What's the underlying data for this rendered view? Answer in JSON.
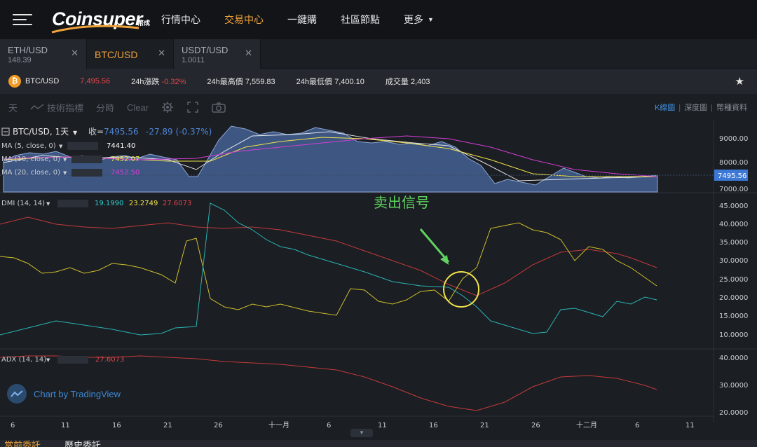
{
  "header": {
    "logo": "Coinsuper",
    "logo_sub": "幣成",
    "nav": [
      {
        "label": "行情中心",
        "active": false
      },
      {
        "label": "交易中心",
        "active": true
      },
      {
        "label": "一鍵購",
        "active": false
      },
      {
        "label": "社區節點",
        "active": false
      }
    ],
    "more_label": "更多"
  },
  "tabs": [
    {
      "pair": "ETH/USD",
      "price": "148.39",
      "active": false
    },
    {
      "pair": "BTC/USD",
      "price": "",
      "active": true
    },
    {
      "pair": "USDT/USD",
      "price": "1.0011",
      "active": false
    }
  ],
  "ticker": {
    "symbol": "BTC/USD",
    "last": "7,495.56",
    "change_label": "24h漲跌",
    "change_value": "-0.32%",
    "high_label": "24h最高價",
    "high_value": "7,559.83",
    "low_label": "24h最低價",
    "low_value": "7,400.10",
    "volume_label": "成交量",
    "volume_value": "2,403"
  },
  "toolbar": {
    "interval": "天",
    "indicators": "技術指標",
    "timeshare": "分時",
    "clear": "Clear",
    "views": [
      "K線圖",
      "深度圖",
      "幣種資料"
    ]
  },
  "chart": {
    "main_legend": "BTC/USD, 1天",
    "close_label": "收=",
    "close_value": "7495.56",
    "change": "-27.89 (-0.37%)",
    "ma5_label": "MA (5, close, 0)",
    "ma5_value": "7441.40",
    "ma10_label": "MA (10, close, 0)",
    "ma10_value": "7452.07",
    "ma20_label": "MA (20, close, 0)",
    "ma20_value": "7452.50",
    "dmi_label": "DMI (14, 14)",
    "dmi_v1": "19.1990",
    "dmi_v2": "23.2749",
    "dmi_v3": "27.6073",
    "adx_label": "ADX (14, 14)",
    "adx_value": "27.6073",
    "annotation": "卖出信号",
    "price_ticks": [
      "9000.00",
      "8000.00",
      "7000.00"
    ],
    "last_price_tag": "7495.56",
    "dmi_ticks": [
      "45.0000",
      "40.0000",
      "35.0000",
      "30.0000",
      "25.0000",
      "20.0000",
      "15.0000",
      "10.0000"
    ],
    "adx_ticks": [
      "40.0000",
      "30.0000",
      "20.0000"
    ],
    "date_ticks": [
      "6",
      "11",
      "16",
      "21",
      "26",
      "十一月",
      "6",
      "11",
      "16",
      "21",
      "26",
      "十二月",
      "6",
      "11"
    ],
    "watermark": "Chart by TradingView"
  },
  "bottom_tabs": [
    "當前委託",
    "歷史委託"
  ],
  "colors": {
    "accent": "#f0a33a",
    "negative": "#e0474c",
    "ma5": "#ffffff",
    "ma10": "#f2e34a",
    "ma20": "#d43fd4",
    "dmi_plus": "#2bb3b3",
    "dmi_minus": "#cfc02c",
    "adx": "#c23a3a"
  }
}
